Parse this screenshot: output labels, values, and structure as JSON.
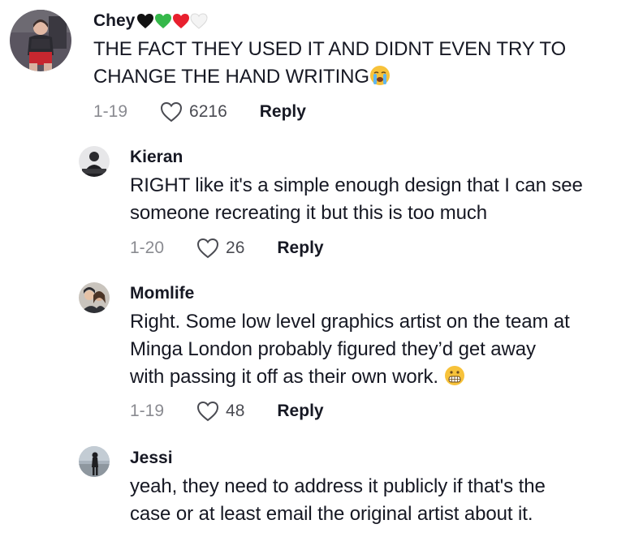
{
  "comments": [
    {
      "username": "Chey",
      "hearts": [
        "black-heart",
        "green-heart",
        "red-heart",
        "white-heart"
      ],
      "lines": [
        "THE FACT THEY USED IT AND DIDNT EVEN TRY TO",
        "CHANGE THE HAND WRITING"
      ],
      "emoji": "loudly-crying-face",
      "date": "1-19",
      "likes": "6216",
      "reply_label": "Reply"
    },
    {
      "username": "Kieran",
      "lines": [
        "RIGHT like it's a simple enough design that I can see",
        "someone recreating it but this is too much"
      ],
      "date": "1-20",
      "likes": "26",
      "reply_label": "Reply"
    },
    {
      "username": "Momlife",
      "lines": [
        "Right. Some low level graphics artist on the team at",
        "Minga London probably figured they’d get away",
        "with passing it off as their own work."
      ],
      "emoji": "grimacing-face",
      "date": "1-19",
      "likes": "48",
      "reply_label": "Reply"
    },
    {
      "username": "Jessi",
      "lines": [
        "yeah, they need to address it publicly if that's the",
        "case or at least email the original artist about it."
      ]
    }
  ],
  "colors": {
    "text": "#161823",
    "secondary": "#8a8b91",
    "like_count": "#4a4b52"
  }
}
